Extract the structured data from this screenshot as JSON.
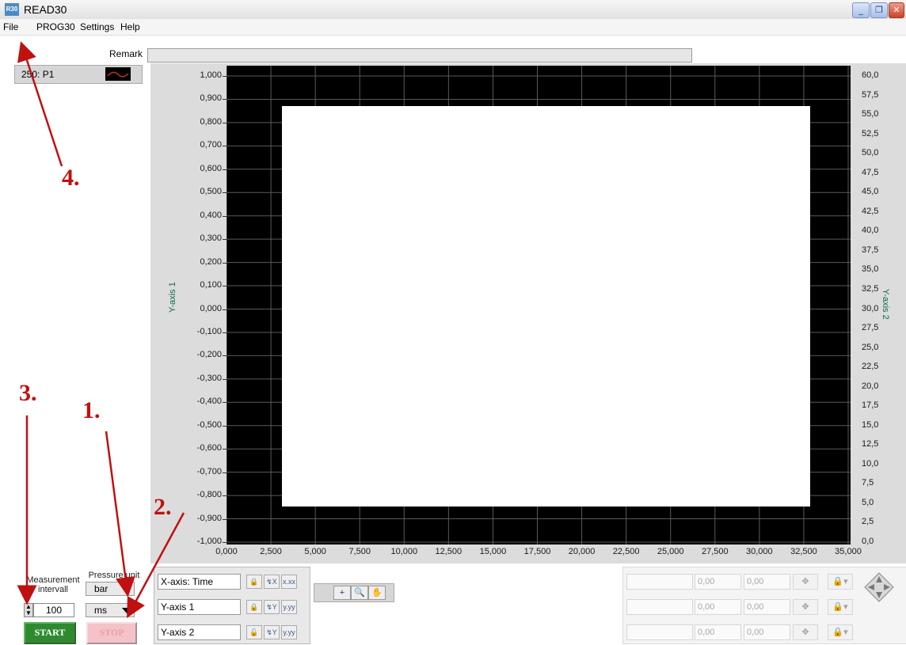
{
  "window": {
    "icon_text": "R30",
    "title": "READ30",
    "minimize": "_",
    "restore": "❐",
    "close": "✕"
  },
  "menu": {
    "items": [
      "File",
      "PROG30",
      "Settings",
      "Help"
    ]
  },
  "remark": {
    "label": "Remark",
    "value": ""
  },
  "legend": {
    "label": "250: P1"
  },
  "graph": {
    "y1_ticks": [
      "1,000",
      "0,900",
      "0,800",
      "0,700",
      "0,600",
      "0,500",
      "0,400",
      "0,300",
      "0,200",
      "0,100",
      "0,000",
      "-0,100",
      "-0,200",
      "-0,300",
      "-0,400",
      "-0,500",
      "-0,600",
      "-0,700",
      "-0,800",
      "-0,900",
      "-1,000"
    ],
    "y2_ticks": [
      "60,0",
      "57,5",
      "55,0",
      "52,5",
      "50,0",
      "47,5",
      "45,0",
      "42,5",
      "40,0",
      "37,5",
      "35,0",
      "32,5",
      "30,0",
      "27,5",
      "25,0",
      "22,5",
      "20,0",
      "17,5",
      "15,0",
      "12,5",
      "10,0",
      "7,5",
      "5,0",
      "2,5",
      "0,0"
    ],
    "x_ticks": [
      "0,000",
      "2,500",
      "5,000",
      "7,500",
      "10,000",
      "12,500",
      "15,000",
      "17,500",
      "20,000",
      "22,500",
      "25,000",
      "27,500",
      "30,000",
      "32,500",
      "35,000"
    ],
    "y1_title": "Y-axis 1",
    "y2_title": "Y-axis 2"
  },
  "controls": {
    "measurement_label_1": "Measurement",
    "measurement_label_2": "intervall",
    "interval_value": "100",
    "pressure_label": "Pressure unit",
    "pressure_unit": "bar",
    "time_unit": "ms",
    "start": "START",
    "stop": "STOP"
  },
  "axes": {
    "rows": [
      {
        "name": "X-axis: Time",
        "btn1": "🔒",
        "btn2": "↯X",
        "btn3": "x.xx"
      },
      {
        "name": "Y-axis 1",
        "btn1": "🔒",
        "btn2": "↯Y",
        "btn3": "y.yy"
      },
      {
        "name": "Y-axis 2",
        "btn1": "🔓",
        "btn2": "↯Y",
        "btn3": "y.yy"
      }
    ]
  },
  "palette": {
    "b1": "+",
    "b2": "🔍",
    "b3": "✋"
  },
  "cursors": {
    "rows": [
      {
        "x": "0,00",
        "y": "0,00"
      },
      {
        "x": "0,00",
        "y": "0,00"
      },
      {
        "x": "0,00",
        "y": "0,00"
      }
    ],
    "move_icon": "✥",
    "lock_icon": "🔒▾"
  },
  "annotations": {
    "a1": "1.",
    "a2": "2.",
    "a3": "3.",
    "a4": "4."
  },
  "colors": {
    "annotation": "#c01010",
    "plot_bg": "#000000",
    "grid": "#5a5a5a",
    "start_green": "#2f8a2f"
  }
}
